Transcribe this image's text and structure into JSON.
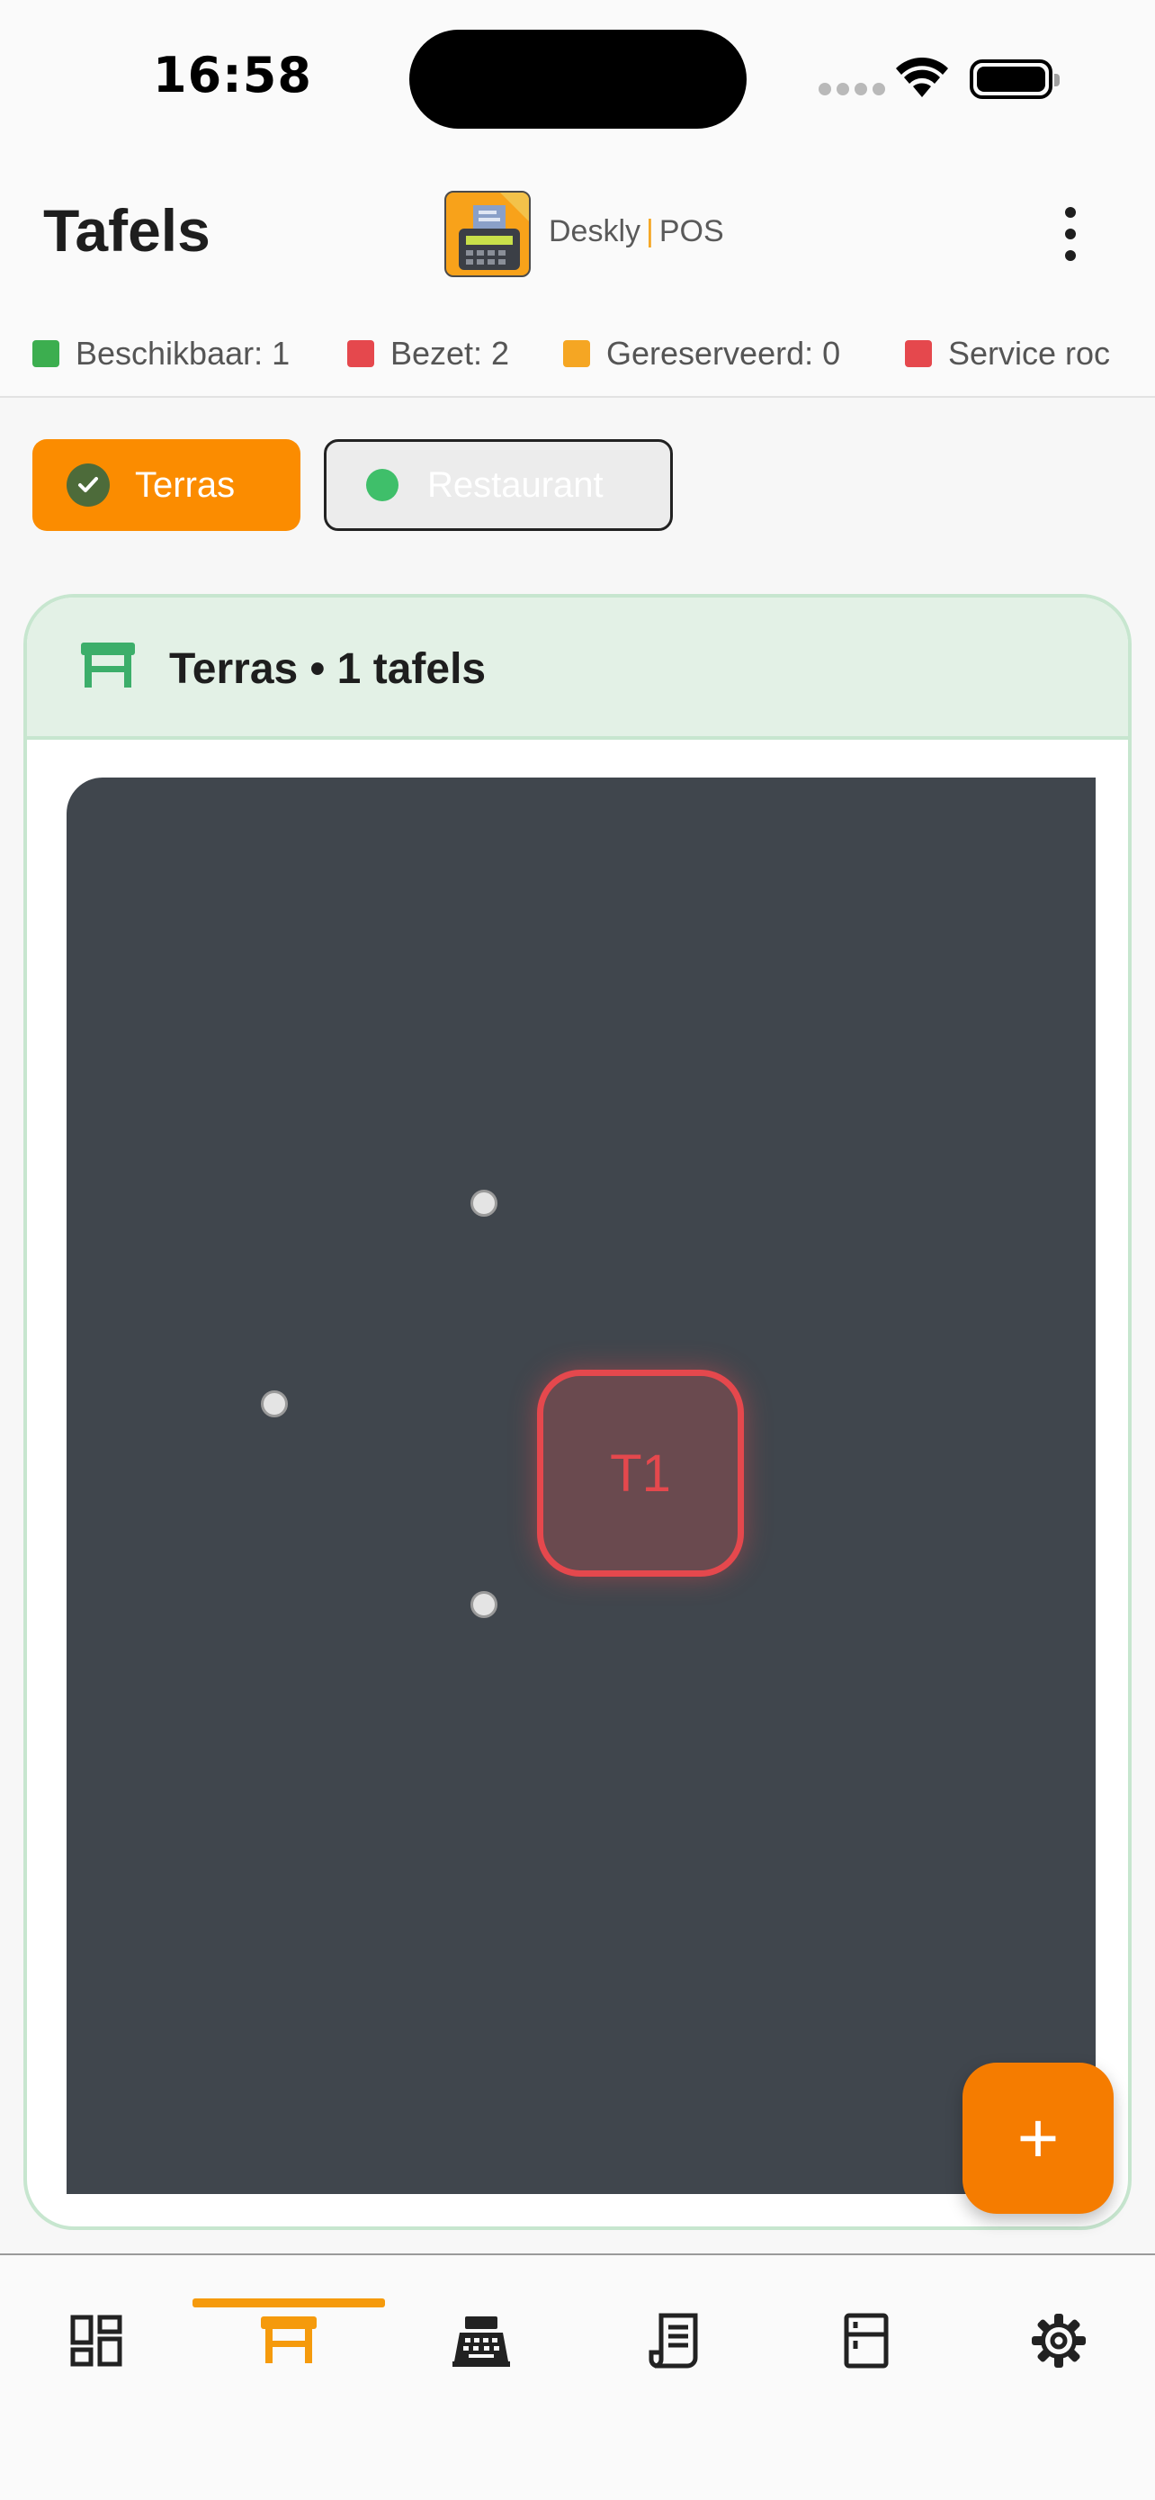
{
  "status_bar": {
    "time": "16:58"
  },
  "header": {
    "title": "Tafels",
    "brand_name": "Deskly",
    "brand_separator": "|",
    "brand_suffix": "POS",
    "menu_icon": "more-vertical-icon"
  },
  "legend": [
    {
      "label": "Beschikbaar: 1",
      "color": "#3cae4f"
    },
    {
      "label": "Bezet: 2",
      "color": "#e5484d"
    },
    {
      "label": "Gereserveerd: 0",
      "color": "#f5a623"
    },
    {
      "label": "Service roc",
      "color": "#e5484d"
    }
  ],
  "areas": {
    "terras": {
      "label": "Terras",
      "selected": true,
      "color": "#fb8c00"
    },
    "restaurant": {
      "label": "Restaurant",
      "selected": false,
      "color": "#3fbf6a"
    }
  },
  "panel": {
    "title": "Terras • 1 tafels",
    "icon": "table-icon"
  },
  "tables": [
    {
      "label": "T1",
      "status_color": "#e5484d"
    }
  ],
  "fab": {
    "label": "+"
  },
  "bottom_nav": {
    "items": [
      {
        "icon": "dashboard-icon",
        "active": false
      },
      {
        "icon": "table-icon",
        "active": true
      },
      {
        "icon": "cash-register-icon",
        "active": false
      },
      {
        "icon": "receipt-icon",
        "active": false
      },
      {
        "icon": "fridge-icon",
        "active": false
      },
      {
        "icon": "settings-icon",
        "active": false
      }
    ],
    "active_color": "#f59a0c"
  }
}
